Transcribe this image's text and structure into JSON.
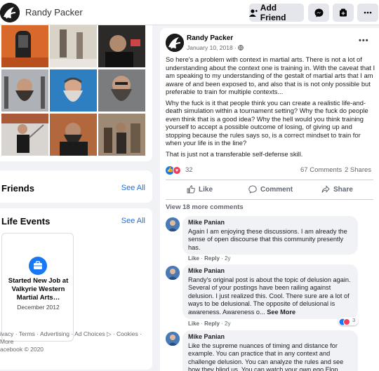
{
  "header": {
    "name": "Randy Packer",
    "add_friend": "Add Friend"
  },
  "friends": {
    "title": "Friends",
    "see_all": "See All"
  },
  "life_events": {
    "title": "Life Events",
    "see_all": "See All",
    "event_title": "Started New Job at Valkyrie Western Martial Arts…",
    "event_date": "December 2012"
  },
  "footer": {
    "line1": "ivacy · Terms · Advertising · Ad Choices ▷ · Cookies · More",
    "line2": "acebook © 2020"
  },
  "post": {
    "author": "Randy Packer",
    "date": "January 10, 2018 · ",
    "paragraphs": [
      "So here's a problem with context in martial arts. There is not a lot of understanding about the context one is training in. With the caveat that I am speaking to my understanding of the gestalt of martial arts that I am aware of and been exposed to, and also that is is not only possible but preferable to train for multiple contexts...",
      "Why the fuck is it that people think you can create a realistic life-and-death simulation within a tournament setting? Why the fuck do people even think that is a good idea? Why the hell would you think training yourself to accept a possible outcome of losing, of giving up and stopping because the rules says so, is a correct mindset to train for when your life is in the line?",
      "That is just not a transferable self-defense skill."
    ],
    "reaction_count": "32",
    "comments_count": "67 Comments",
    "shares_count": "2 Shares",
    "like_label": "Like",
    "comment_label": "Comment",
    "share_label": "Share",
    "view_more": "View 18 more comments"
  },
  "comments": [
    {
      "name": "Mike Panian",
      "text": "Again I am enjoying these discussions. I am already the sense of open discourse that this community presently has.",
      "like": "Like",
      "reply": "Reply",
      "time": "2y"
    },
    {
      "name": "Mike Panian",
      "text": "Randy's original post is about the topic of delusion again. Several of your postings have been railing against delusion. I just realized this. Cool. There sure are a lot of ways to be delusional. The opposite of delusional is awareness. Awareness o...",
      "see_more": "See More",
      "reaction_count": "3",
      "like": "Like",
      "reply": "Reply",
      "time": "2y"
    },
    {
      "name": "Mike Panian",
      "text": "Like the supreme nuances of timing and distance for example. You can practice that in any context and challenge delusion. You can analyze the rules and see how they blind us. You can watch your own ego Flop"
    }
  ]
}
